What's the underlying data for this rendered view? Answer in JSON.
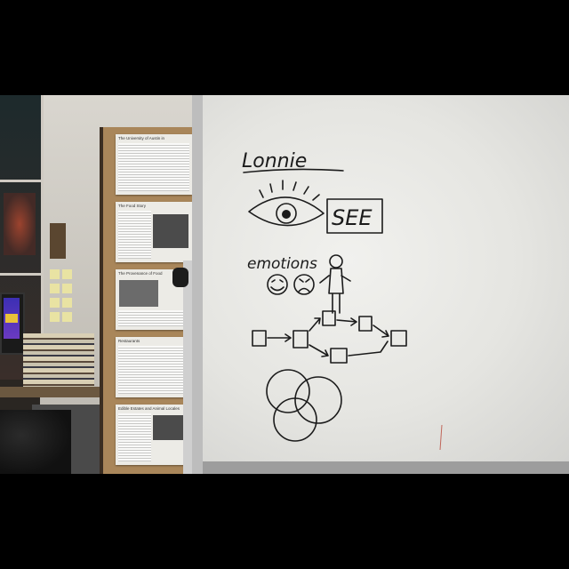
{
  "scene": {
    "whiteboard": {
      "name_text": "Lonnie",
      "see_text": "SEE",
      "emotions_text": "emotions"
    },
    "posters": [
      {
        "title": "The University of Austin in"
      },
      {
        "title": "The Food Story"
      },
      {
        "title": "The Provenance of Food"
      },
      {
        "title": "Restaurants"
      },
      {
        "title": "Edible Estates and Animal Locales"
      }
    ]
  }
}
